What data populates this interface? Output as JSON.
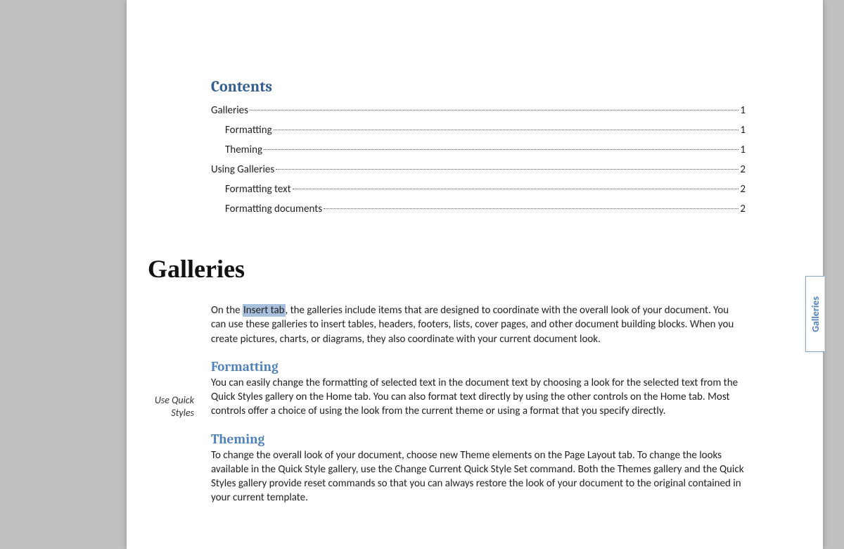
{
  "toc": {
    "title": "Contents",
    "entries": [
      {
        "label": "Galleries",
        "page": "1",
        "level": 1
      },
      {
        "label": "Formatting",
        "page": "1",
        "level": 2
      },
      {
        "label": "Theming",
        "page": "1",
        "level": 2
      },
      {
        "label": "Using Galleries",
        "page": "2",
        "level": 1
      },
      {
        "label": "Formatting text",
        "page": "2",
        "level": 2
      },
      {
        "label": "Formatting documents",
        "page": "2",
        "level": 2
      }
    ]
  },
  "heading": "Galleries",
  "intro": {
    "pre": "On the ",
    "highlight": "Insert tab",
    "post": ", the galleries include items that are designed to coordinate with the overall look of your document. You can use these galleries to insert tables, headers, footers, lists, cover pages, and other document building blocks. When you create pictures, charts, or diagrams, they also coordinate with your current document look."
  },
  "sections": [
    {
      "title": "Formatting",
      "body": "You can easily change the formatting of selected text in the document text by choosing a look for the selected text from the Quick Styles gallery on the Home tab. You can also format text directly by using the other controls on the Home tab. Most controls offer a choice of using the look from the current theme or using a format that you specify directly."
    },
    {
      "title": "Theming",
      "body": "To change the overall look of your document, choose new Theme elements on the Page Layout tab. To change the looks available in the Quick Style gallery, use the Change Current Quick Style Set command. Both the Themes gallery and the Quick Styles gallery provide reset commands so that you can always restore the look of your document to the original contained in your current template."
    }
  ],
  "margin_note": "Use Quick Styles",
  "side_tab": "Galleries"
}
